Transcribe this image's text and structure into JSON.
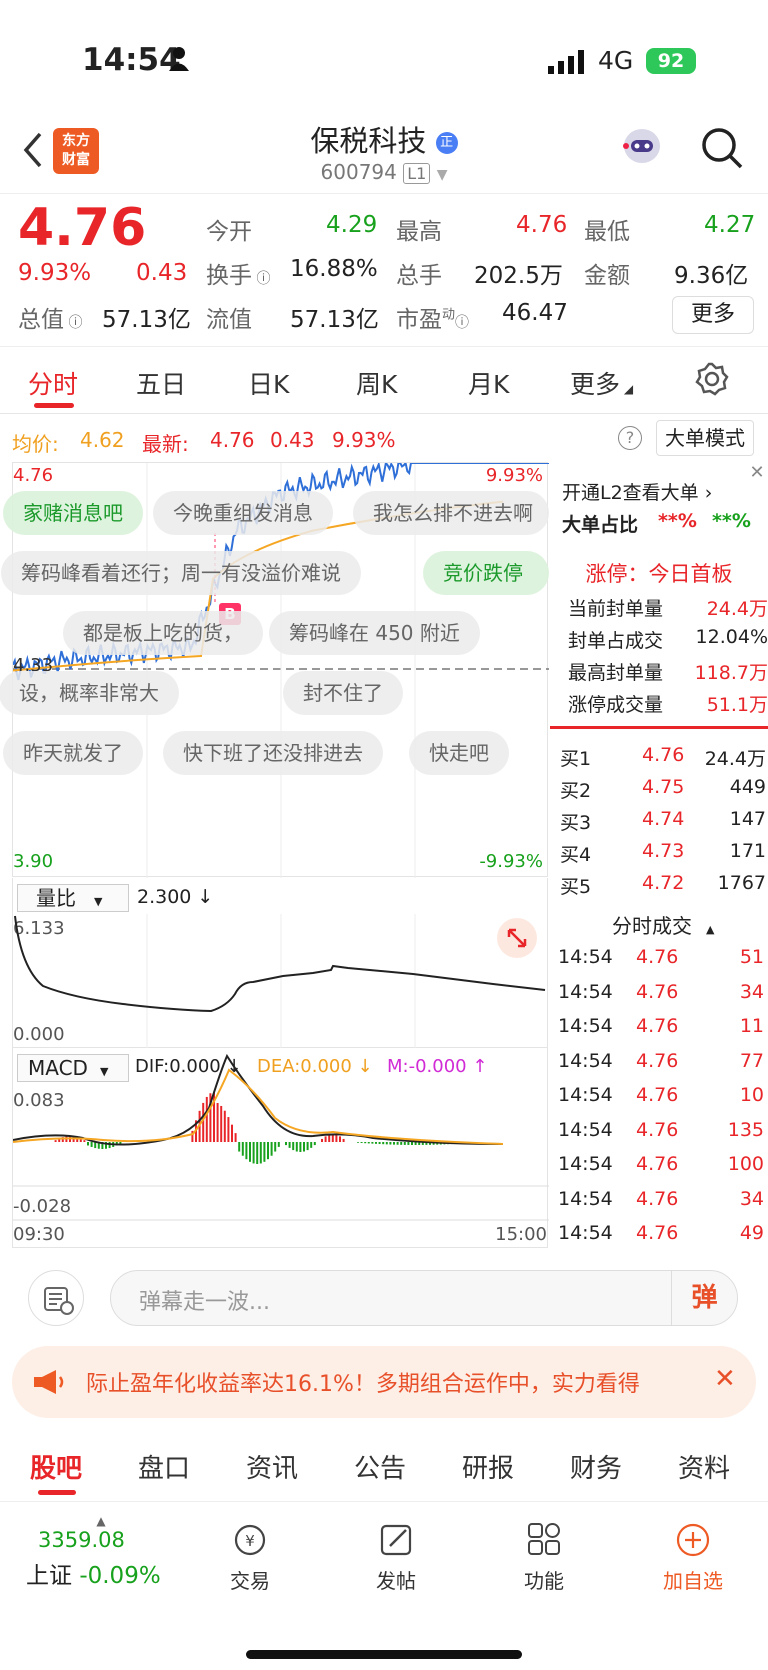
{
  "status": {
    "time": "14:54",
    "network": "4G",
    "battery": "92"
  },
  "header": {
    "title": "保税科技",
    "code": "600794",
    "level": "L1",
    "logo_lines": [
      "东方",
      "财富"
    ]
  },
  "quote": {
    "price": "4.76",
    "pct": "9.93%",
    "change": "0.43",
    "open_label": "今开",
    "open": "4.29",
    "high_label": "最高",
    "high": "4.76",
    "low_label": "最低",
    "low": "4.27",
    "turnover_label": "换手",
    "turnover": "16.88%",
    "volume_label": "总手",
    "volume": "202.5万",
    "amount_label": "金额",
    "amount": "9.36亿",
    "mktcap_label": "总值",
    "mktcap": "57.13亿",
    "float_label": "流值",
    "float": "57.13亿",
    "pe_label": "市盈",
    "pe_sup": "动",
    "pe": "46.47",
    "more": "更多"
  },
  "tabs": [
    "分时",
    "五日",
    "日K",
    "周K",
    "月K",
    "更多"
  ],
  "chart_header": {
    "avg_label": "均价:",
    "avg": "4.62",
    "latest_label": "最新:",
    "latest": "4.76",
    "chg": "0.43",
    "pct": "9.93%",
    "mode": "大单模式"
  },
  "chart": {
    "top_left": "4.76",
    "top_right": "9.93%",
    "mid_left": "4.33",
    "bot_left": "3.90",
    "bot_right": "-9.93%",
    "b_marker": "B",
    "danmu": [
      "家赌消息吧",
      "今晚重组发消息",
      "我怎么排不进去啊",
      "筹码峰看着还行；周一有没溢价难说",
      "竞价跌停",
      "都是板上吃的货，",
      "筹码峰在 450 附近",
      "设，概率非常大",
      "封不住了",
      "昨天就发了",
      "快下班了还没排进去",
      "快走吧"
    ],
    "volratio_label": "量比",
    "volratio_val": "2.300 ↓",
    "vr_top": "6.133",
    "vr_bot": "0.000",
    "macd_label": "MACD",
    "dif": "DIF:0.000 ↓",
    "dea": "DEA:0.000 ↓",
    "m": "M:-0.000 ↑",
    "macd_top": "0.083",
    "macd_bot": "-0.028",
    "t_start": "09:30",
    "t_end": "15:00"
  },
  "chart_data": {
    "type": "line",
    "x": [
      "09:30",
      "15:00"
    ],
    "series": [
      {
        "values": [
          4.33,
          4.35,
          4.36,
          4.37,
          4.38,
          4.62,
          4.7,
          4.72,
          4.74,
          4.76,
          4.76,
          4.76,
          4.76
        ]
      }
    ],
    "ylim": [
      3.9,
      4.76
    ]
  },
  "panel": {
    "l2_text": "开通L2查看大单",
    "big_label": "大单占比",
    "big_v1": "**%",
    "big_v2": "**%",
    "limit_title": "涨停：今日首板",
    "rows": [
      {
        "label": "当前封单量",
        "value": "24.4万"
      },
      {
        "label": "封单占成交",
        "value": "12.04%"
      },
      {
        "label": "最高封单量",
        "value": "118.7万"
      },
      {
        "label": "涨停成交量",
        "value": "51.1万"
      }
    ],
    "bids": [
      {
        "label": "买1",
        "price": "4.76",
        "vol": "24.4万"
      },
      {
        "label": "买2",
        "price": "4.75",
        "vol": "449"
      },
      {
        "label": "买3",
        "price": "4.74",
        "vol": "147"
      },
      {
        "label": "买4",
        "price": "4.73",
        "vol": "171"
      },
      {
        "label": "买5",
        "price": "4.72",
        "vol": "1767"
      }
    ],
    "ticks_title": "分时成交",
    "ticks": [
      {
        "t": "14:54",
        "p": "4.76",
        "v": "51"
      },
      {
        "t": "14:54",
        "p": "4.76",
        "v": "34"
      },
      {
        "t": "14:54",
        "p": "4.76",
        "v": "11"
      },
      {
        "t": "14:54",
        "p": "4.76",
        "v": "77"
      },
      {
        "t": "14:54",
        "p": "4.76",
        "v": "10"
      },
      {
        "t": "14:54",
        "p": "4.76",
        "v": "135"
      },
      {
        "t": "14:54",
        "p": "4.76",
        "v": "100"
      },
      {
        "t": "14:54",
        "p": "4.76",
        "v": "34"
      },
      {
        "t": "14:54",
        "p": "4.76",
        "v": "49"
      }
    ]
  },
  "input": {
    "placeholder": "弹幕走一波...",
    "send": "弹"
  },
  "banner": {
    "text": "际止盈年化收益率达16.1%！多期组合运作中，实力看得"
  },
  "subtabs": [
    "股吧",
    "盘口",
    "资讯",
    "公告",
    "研报",
    "财务",
    "资料"
  ],
  "footer": {
    "index_value": "3359.08",
    "index_name": "上证",
    "index_pct": "-0.09%",
    "buttons": [
      "交易",
      "发帖",
      "功能",
      "加自选"
    ]
  }
}
